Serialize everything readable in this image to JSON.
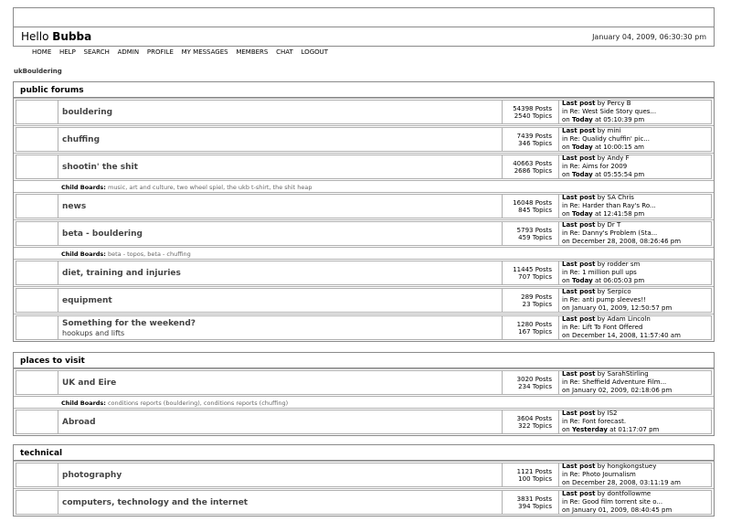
{
  "header": {
    "greeting": "Hello",
    "username": "Bubba",
    "datetime": "January 04, 2009, 06:30:30 pm"
  },
  "nav": [
    "HOME",
    "HELP",
    "SEARCH",
    "ADMIN",
    "PROFILE",
    "MY MESSAGES",
    "MEMBERS",
    "CHAT",
    "LOGOUT"
  ],
  "breadcrumb": "ukBouldering",
  "categories": [
    {
      "title": "public forums",
      "boards": [
        {
          "name": "bouldering",
          "posts": "54398 Posts",
          "topics": "2540 Topics",
          "by": "Percy B",
          "in": "West Side Story ques...",
          "on": "Today",
          "at": "at 05:10:39 pm"
        },
        {
          "name": "chuffing",
          "posts": "7439 Posts",
          "topics": "346 Topics",
          "by": "mini",
          "in": "Qualidy chuffin' pic...",
          "on": "Today",
          "at": "at 10:00:15 am"
        },
        {
          "name": "shootin' the shit",
          "posts": "40663 Posts",
          "topics": "2686 Topics",
          "by": "Andy F",
          "in": "Aims for 2009",
          "on": "Today",
          "at": "at 05:55:54 pm",
          "child": "music, art and culture, two wheel spiel, the ukb t-shirt, the shit heap"
        },
        {
          "name": "news",
          "posts": "16048 Posts",
          "topics": "845 Topics",
          "by": "SA Chris",
          "in": "Harder than Ray's Ro...",
          "on": "Today",
          "at": "at 12:41:58 pm"
        },
        {
          "name": "beta - bouldering",
          "posts": "5793 Posts",
          "topics": "459 Topics",
          "by": "Dr T",
          "in": "Danny's Problem (Sta...",
          "on": "December 28, 2008, 08:26:46 pm",
          "at": "",
          "child": "beta - topos, beta - chuffing"
        },
        {
          "name": "diet, training and injuries",
          "posts": "11445 Posts",
          "topics": "707 Topics",
          "by": "rodder sm",
          "in": "1 million pull ups",
          "on": "Today",
          "at": "at 06:05:03 pm"
        },
        {
          "name": "equipment",
          "posts": "289 Posts",
          "topics": "23 Topics",
          "by": "Serpico",
          "in": "anti pump sleeves!!",
          "on": "January 01, 2009, 12:50:57 pm",
          "at": ""
        },
        {
          "name": "Something for the weekend?",
          "sub": "hookups and lifts",
          "posts": "1280 Posts",
          "topics": "167 Topics",
          "by": "Adam Lincoln",
          "in": "Lift To Font Offered",
          "on": "December 14, 2008, 11:57:40 am",
          "at": ""
        }
      ]
    },
    {
      "title": "places to visit",
      "boards": [
        {
          "name": "UK and Eire",
          "posts": "3020 Posts",
          "topics": "234 Topics",
          "by": "SarahStirling",
          "in": "Sheffield Adventure Film...",
          "on": "January 02, 2009, 02:18:06 pm",
          "at": "",
          "child": "conditions reports (bouldering), conditions reports (chuffing)"
        },
        {
          "name": "Abroad",
          "posts": "3604 Posts",
          "topics": "322 Topics",
          "by": "IS2",
          "in": "Font forecast.",
          "on": "Yesterday",
          "at": "at 01:17:07 pm"
        }
      ]
    },
    {
      "title": "technical",
      "boards": [
        {
          "name": "photography",
          "posts": "1121 Posts",
          "topics": "100 Topics",
          "by": "hongkongstuey",
          "in": "Photo Journalism",
          "on": "December 28, 2008, 03:11:19 am",
          "at": ""
        },
        {
          "name": "computers, technology and the internet",
          "posts": "3831 Posts",
          "topics": "394 Topics",
          "by": "dontfollowme",
          "in": "Good film torrent site o...",
          "on": "January 01, 2009, 08:40:45 pm",
          "at": ""
        }
      ]
    }
  ],
  "labels": {
    "last_post": "Last post",
    "by": "by",
    "in": "in Re:",
    "on": "on",
    "child_boards": "Child Boards:"
  }
}
